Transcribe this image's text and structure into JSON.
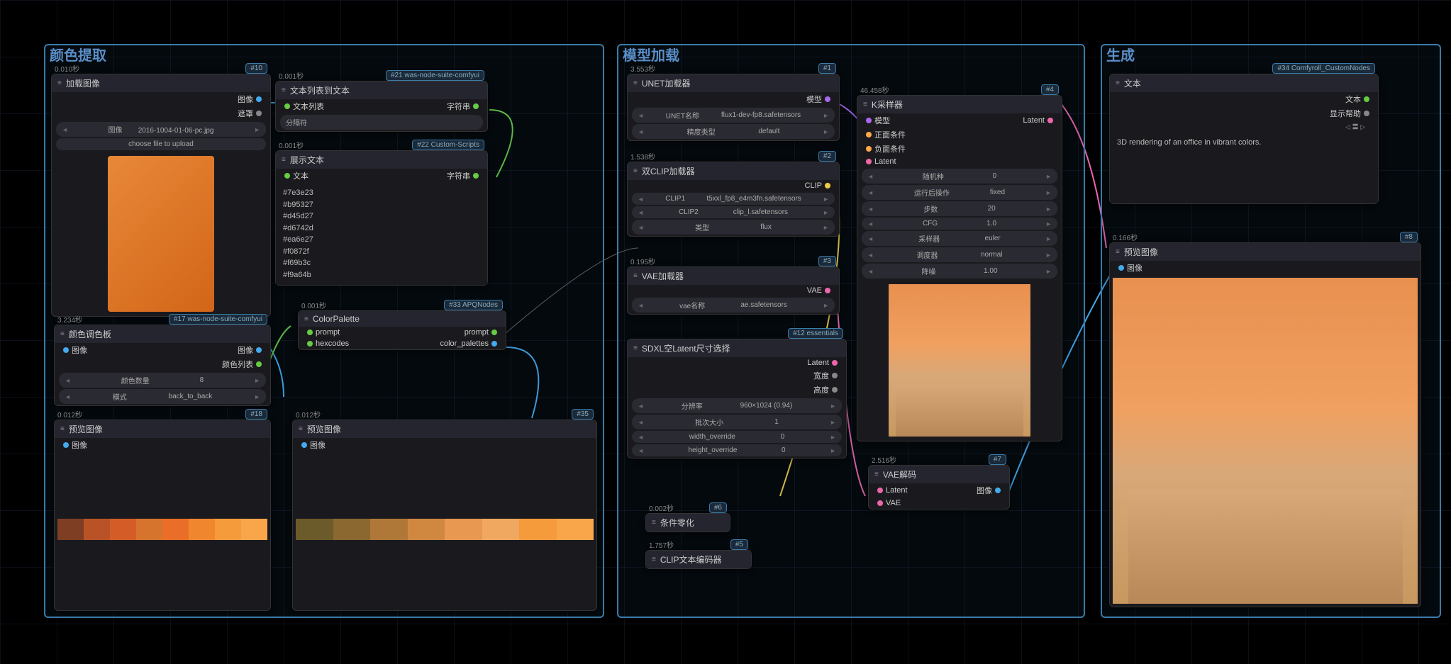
{
  "groups": {
    "g1": {
      "label": "颜色提取"
    },
    "g2": {
      "label": "模型加载"
    },
    "g3": {
      "label": "生成"
    }
  },
  "nodes": {
    "n10": {
      "title": "加载图像",
      "badge": "#10",
      "timing": "0.010秒",
      "out1": "图像",
      "out2": "遮罩",
      "w_img": {
        "label": "图像",
        "value": "2016-1004-01-06-pc.jpg"
      },
      "upload": "choose file to upload"
    },
    "n21": {
      "title": "文本列表到文本",
      "badge": "#21 was-node-suite-comfyui",
      "timing": "0.001秒",
      "in1": "文本列表",
      "out1": "字符串",
      "w1": "分隔符"
    },
    "n22": {
      "title": "展示文本",
      "badge": "#22 Custom-Scripts",
      "timing": "0.001秒",
      "in1": "文本",
      "out1": "字符串",
      "hexcodes": [
        "#7e3e23",
        "#b95327",
        "#d45d27",
        "#d6742d",
        "#ea6e27",
        "#f0872f",
        "#f69b3c",
        "#f9a64b"
      ]
    },
    "n17": {
      "title": "颜色调色板",
      "badge": "#17 was-node-suite-comfyui",
      "timing": "3.234秒",
      "in1": "图像",
      "out1": "图像",
      "out2": "颜色列表",
      "w1": {
        "label": "颜色数量",
        "value": "8"
      },
      "w2": {
        "label": "模式",
        "value": "back_to_back"
      }
    },
    "n33": {
      "title": "ColorPalette",
      "badge": "#33 APQNodes",
      "timing": "0.001秒",
      "in1": "prompt",
      "in2": "hexcodes",
      "out1": "prompt",
      "out2": "color_palettes"
    },
    "n18": {
      "title": "预览图像",
      "badge": "#18",
      "timing": "0.012秒",
      "in1": "图像"
    },
    "n35": {
      "title": "预览图像",
      "badge": "#35",
      "timing": "0.012秒",
      "in1": "图像"
    },
    "n1": {
      "title": "UNET加载器",
      "badge": "#1",
      "timing": "3.553秒",
      "out1": "模型",
      "w1": {
        "label": "UNET名称",
        "value": "flux1-dev-fp8.safetensors"
      },
      "w2": {
        "label": "精度类型",
        "value": "default"
      }
    },
    "n2": {
      "title": "双CLIP加载器",
      "badge": "#2",
      "timing": "1.538秒",
      "out1": "CLIP",
      "w1": {
        "label": "CLIP1",
        "value": "t5xxl_fp8_e4m3fn.safetensors"
      },
      "w2": {
        "label": "CLIP2",
        "value": "clip_l.safetensors"
      },
      "w3": {
        "label": "类型",
        "value": "flux"
      }
    },
    "n3": {
      "title": "VAE加载器",
      "badge": "#3",
      "timing": "0.195秒",
      "out1": "VAE",
      "w1": {
        "label": "vae名称",
        "value": "ae.safetensors"
      }
    },
    "n12": {
      "title": "SDXL空Latent尺寸选择",
      "badge": "#12 essentials",
      "out1": "Latent",
      "out2": "宽度",
      "out3": "高度",
      "w1": {
        "label": "分辨率",
        "value": "960×1024 (0.94)"
      },
      "w2": {
        "label": "批次大小",
        "value": "1"
      },
      "w3": {
        "label": "width_override",
        "value": "0"
      },
      "w4": {
        "label": "height_override",
        "value": "0"
      }
    },
    "n4": {
      "title": "K采样器",
      "badge": "#4",
      "timing": "46.458秒",
      "in1": "模型",
      "in2": "正面条件",
      "in3": "负面条件",
      "in4": "Latent",
      "out1": "Latent",
      "w1": {
        "label": "随机种",
        "value": "0"
      },
      "w2": {
        "label": "运行后操作",
        "value": "fixed"
      },
      "w3": {
        "label": "步数",
        "value": "20"
      },
      "w4": {
        "label": "CFG",
        "value": "1.0"
      },
      "w5": {
        "label": "采样器",
        "value": "euler"
      },
      "w6": {
        "label": "调度器",
        "value": "normal"
      },
      "w7": {
        "label": "降噪",
        "value": "1.00"
      }
    },
    "n7": {
      "title": "VAE解码",
      "badge": "#7",
      "timing": "2.516秒",
      "in1": "Latent",
      "in2": "VAE",
      "out1": "图像"
    },
    "n6": {
      "title": "条件零化",
      "badge": "#6",
      "timing": "0.002秒"
    },
    "n5": {
      "title": "CLIP文本编码器",
      "badge": "#5",
      "timing": "1.757秒"
    },
    "n34": {
      "title": "文本",
      "badge": "#34 Comfyroll_CustomNodes",
      "out1": "文本",
      "out2": "显示帮助",
      "text": "3D rendering of an office in vibrant colors."
    },
    "n8": {
      "title": "预览图像",
      "badge": "#8",
      "timing": "0.166秒",
      "in1": "图像"
    }
  },
  "palette18": [
    "#7e3e23",
    "#b95327",
    "#d45d27",
    "#d6742d",
    "#ea6e27",
    "#f0872f",
    "#f69b3c",
    "#f9a64b"
  ],
  "palette35": [
    "#6b5a2a",
    "#8a6830",
    "#b07838",
    "#d08840",
    "#e89850",
    "#f0a860",
    "#f69b3c",
    "#f9a64b"
  ]
}
